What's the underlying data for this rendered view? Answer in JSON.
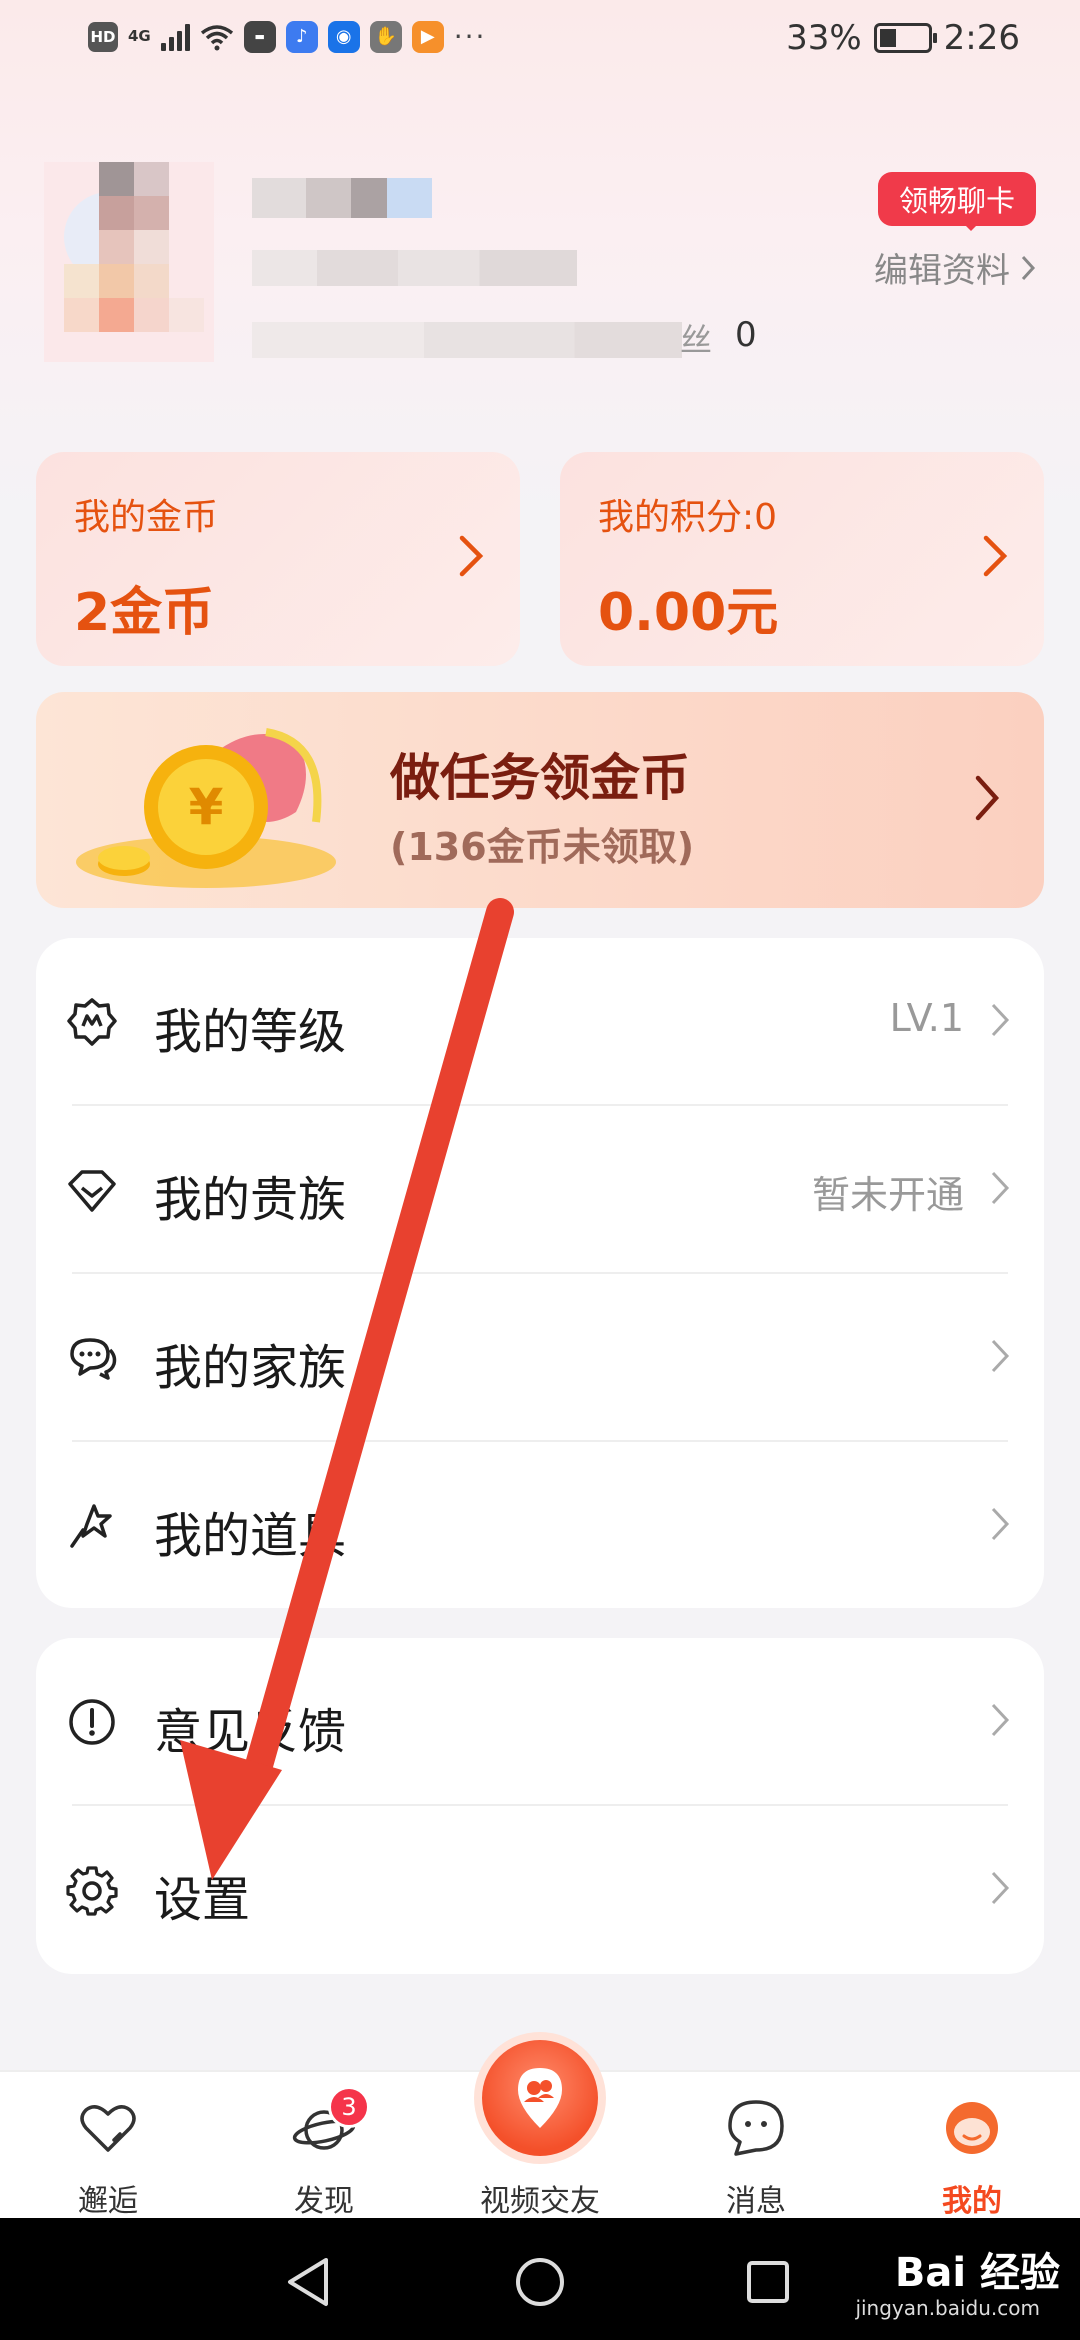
{
  "status_bar": {
    "hd": "HD",
    "network": "4G",
    "battery_pct": "33%",
    "time": "2:26",
    "more": "···"
  },
  "profile": {
    "fans_count": "0",
    "fans_label": "丝",
    "chat_card_badge": "领畅聊卡",
    "edit_profile": "编辑资料"
  },
  "wallet": {
    "coins_label": "我的金币",
    "coins_value": "2金币",
    "points_label": "我的积分:0",
    "points_value": "0.00元"
  },
  "task_banner": {
    "title": "做任务领金币",
    "subtitle": "(136金币未领取)"
  },
  "menu": {
    "level_label": "我的等级",
    "level_value": "LV.1",
    "noble_label": "我的贵族",
    "noble_value": "暂未开通",
    "family_label": "我的家族",
    "props_label": "我的道具",
    "feedback_label": "意见反馈",
    "settings_label": "设置"
  },
  "bottom_nav": {
    "items": [
      {
        "label": "邂逅",
        "icon": "heart-icon"
      },
      {
        "label": "发现",
        "icon": "planet-icon",
        "badge": "3"
      },
      {
        "label": "视频交友",
        "icon": "video-friends-icon"
      },
      {
        "label": "消息",
        "icon": "chat-bubble-icon"
      },
      {
        "label": "我的",
        "icon": "profile-icon",
        "active": true
      }
    ]
  },
  "watermark": {
    "brand": "Bai 经验",
    "url": "jingyan.baidu.com"
  },
  "colors": {
    "accent": "#f4491f",
    "coin_text": "#e55210",
    "badge_red": "#f03a4a",
    "annotation_arrow": "#e8412f"
  }
}
